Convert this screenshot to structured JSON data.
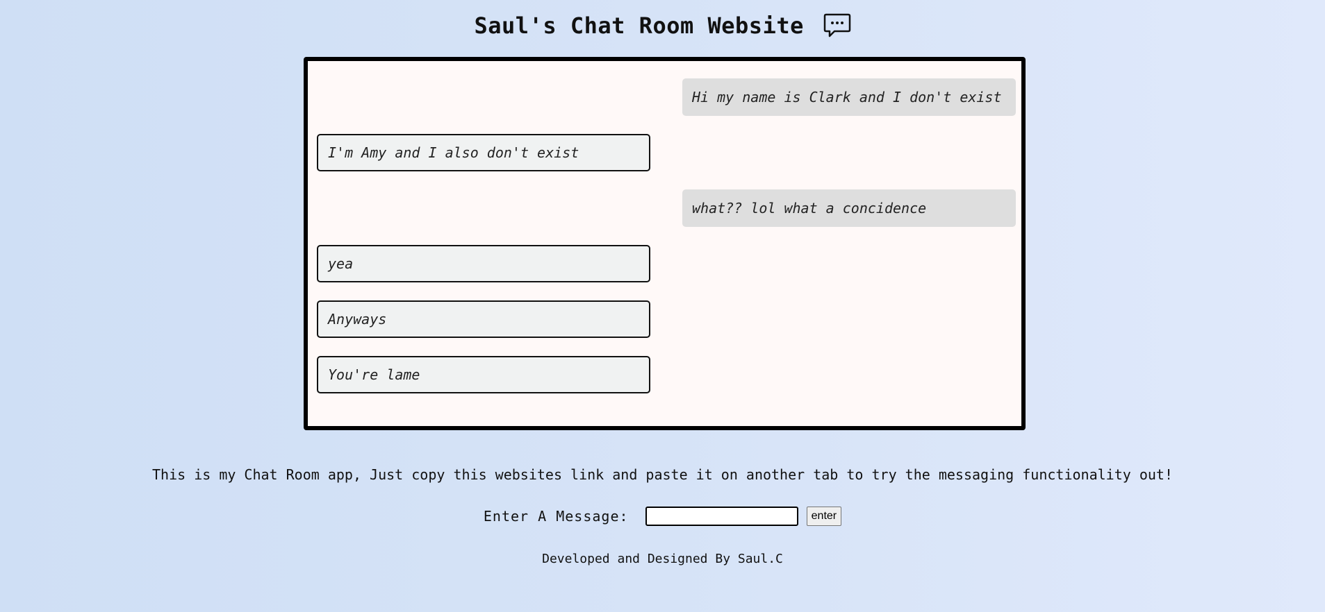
{
  "header": {
    "title": "Saul's Chat Room Website",
    "icon": "speech-bubble-icon"
  },
  "messages": [
    {
      "side": "right",
      "text": "Hi my name is Clark and I don't exist"
    },
    {
      "side": "left",
      "text": "I'm Amy and I also don't exist"
    },
    {
      "side": "right",
      "text": "what?? lol what a concidence"
    },
    {
      "side": "left",
      "text": "yea"
    },
    {
      "side": "left",
      "text": "Anyways"
    },
    {
      "side": "left",
      "text": "You're lame"
    }
  ],
  "info": {
    "text": "This is my Chat Room app, Just copy this websites link and paste it on another tab to try the messaging functionality out!"
  },
  "entry": {
    "label": "Enter A Message:",
    "input_value": "",
    "button_label": "enter"
  },
  "footer": {
    "text": "Developed and Designed By Saul.C"
  },
  "colors": {
    "background_start": "#cfdff5",
    "background_end": "#e0e9fb",
    "chat_box_bg": "#fff9f8",
    "right_bubble": "#dedede",
    "left_bubble": "#f0f2f2"
  }
}
